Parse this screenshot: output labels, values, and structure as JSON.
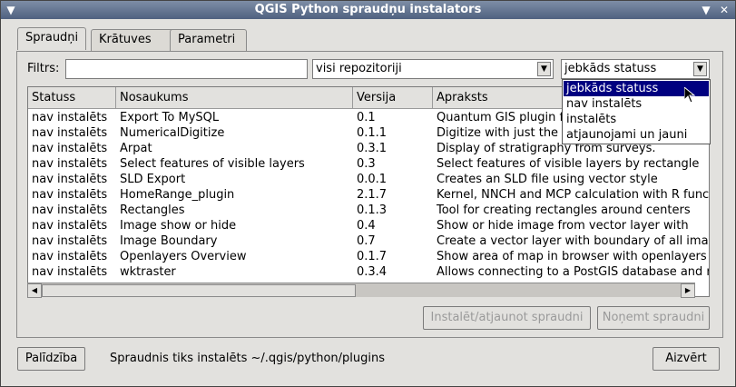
{
  "window": {
    "title": "QGIS Python spraudņu instalators",
    "menu_icon": "chevron-down-icon",
    "minimize_icon": "chevron-down-icon",
    "close_icon": "close-icon"
  },
  "tabs": [
    {
      "label": "Spraudņi"
    },
    {
      "label": "Krātuves"
    },
    {
      "label": "Parametri"
    }
  ],
  "filter": {
    "label": "Filtrs:",
    "value": "",
    "repo_selected": "visi repozitoriji",
    "status_selected": "jebkāds statuss"
  },
  "table": {
    "headers": [
      "Statuss",
      "Nosaukums",
      "Versija",
      "Apraksts"
    ],
    "rows": [
      [
        "nav instalēts",
        "Export To MySQL",
        "0.1",
        "Quantum GIS plugin for exporting vector layers to MySQL"
      ],
      [
        "nav instalēts",
        "NumericalDigitize",
        "0.1.1",
        "Digitize with just the keyboard"
      ],
      [
        "nav instalēts",
        "Arpat",
        "0.3.1",
        "Display of stratigraphy from surveys."
      ],
      [
        "nav instalēts",
        "Select features of visible layers",
        "0.3",
        "Select features of visible layers by rectangle"
      ],
      [
        "nav instalēts",
        "SLD Export",
        "0.0.1",
        "Creates an SLD file using vector style"
      ],
      [
        "nav instalēts",
        "HomeRange_plugin",
        "2.1.7",
        "Kernel, NNCH and MCP calculation with R functions"
      ],
      [
        "nav instalēts",
        "Rectangles",
        "0.1.3",
        "Tool for creating rectangles around centers"
      ],
      [
        "nav instalēts",
        "Image show or hide",
        "0.4",
        "Show or hide image from vector layer with"
      ],
      [
        "nav instalēts",
        "Image Boundary",
        "0.7",
        "Create a vector layer with boundary of all images"
      ],
      [
        "nav instalēts",
        "Openlayers Overview",
        "0.1.7",
        "Show area of map in browser with openlayers"
      ],
      [
        "nav instalēts",
        "wktraster",
        "0.3.4",
        "Allows connecting to a PostGIS database and reading rasters"
      ]
    ]
  },
  "status_dropdown": {
    "options": [
      "jebkāds statuss",
      "nav instalēts",
      "instalēts",
      "atjaunojami un jauni"
    ],
    "selected_index": 0
  },
  "buttons": {
    "install": "Instalēt/atjaunot spraudni",
    "uninstall": "Noņemt spraudni",
    "help": "Palīdzība",
    "close": "Aizvērt"
  },
  "status_text": "Spraudnis tiks instalēts ~/.qgis/python/plugins",
  "icons": {
    "scroll_left": "arrow-left-icon",
    "scroll_right": "arrow-right-icon",
    "combo_arrow": "chevron-down-icon"
  },
  "colors": {
    "selection": "#000080",
    "titlebar": "#5b6d8c"
  }
}
